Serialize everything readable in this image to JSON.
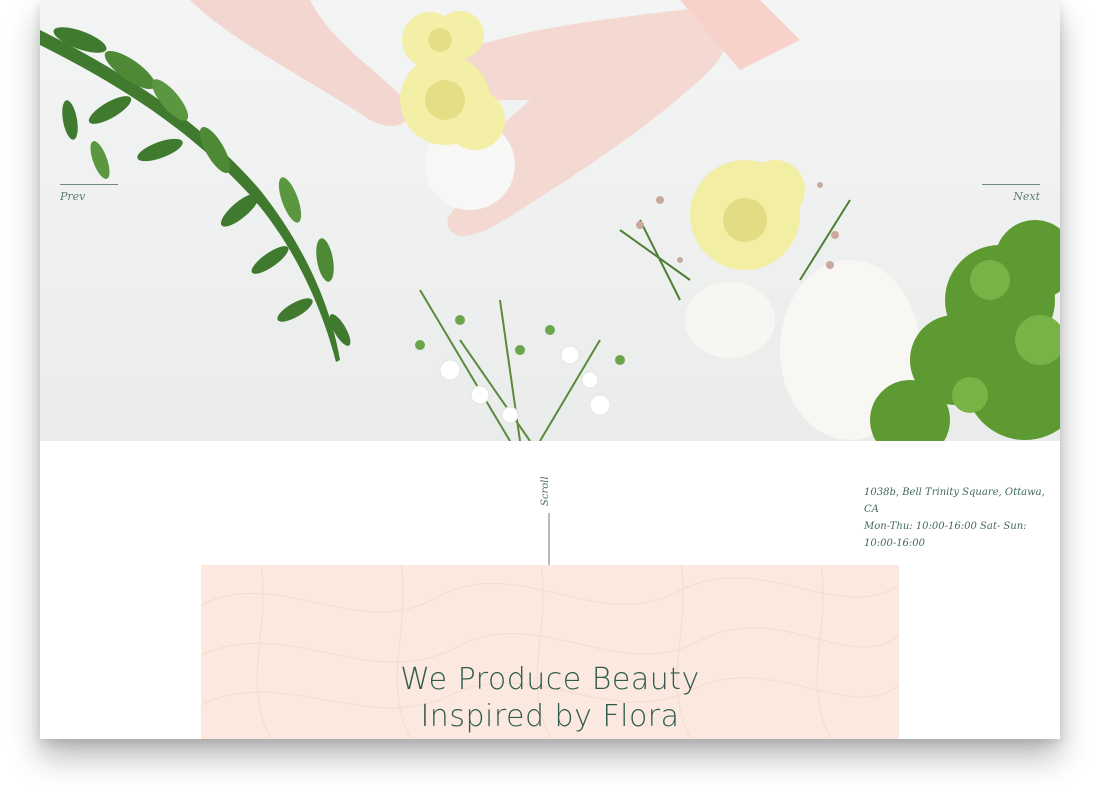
{
  "slider": {
    "prev_label": "Prev",
    "next_label": "Next"
  },
  "scroll": {
    "label": "Scroll"
  },
  "contact": {
    "address": "1038b, Bell Trinity Square, Ottawa, CA",
    "hours": "Mon-Thu: 10:00-16:00 Sat- Sun: 10:00-16:00"
  },
  "promo": {
    "title_line1": "We Produce Beauty",
    "title_line2": "Inspired by Flora"
  },
  "colors": {
    "accent": "#2f5a4c",
    "promo_bg": "#fbe9df",
    "text_muted": "#5f7c73"
  },
  "icons": {
    "scroll": "arrow-down-icon"
  }
}
